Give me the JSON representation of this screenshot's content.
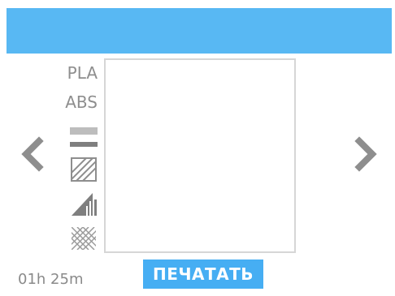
{
  "materials": {
    "pla_label": "PLA",
    "abs_label": "ABS"
  },
  "settings_icons": [
    "layer-height-icon",
    "shell-thickness-icon",
    "print-speed-icon",
    "infill-density-icon"
  ],
  "navigation": {
    "prev_icon": "chevron-left-icon",
    "next_icon": "chevron-right-icon"
  },
  "status": {
    "time_estimate": "01h 25m"
  },
  "actions": {
    "print_label": "ПЕЧАТАТЬ"
  },
  "colors": {
    "header_bar": "#58b8f3",
    "print_button": "#46aef3",
    "icon_gray": "#8e8e8e"
  }
}
